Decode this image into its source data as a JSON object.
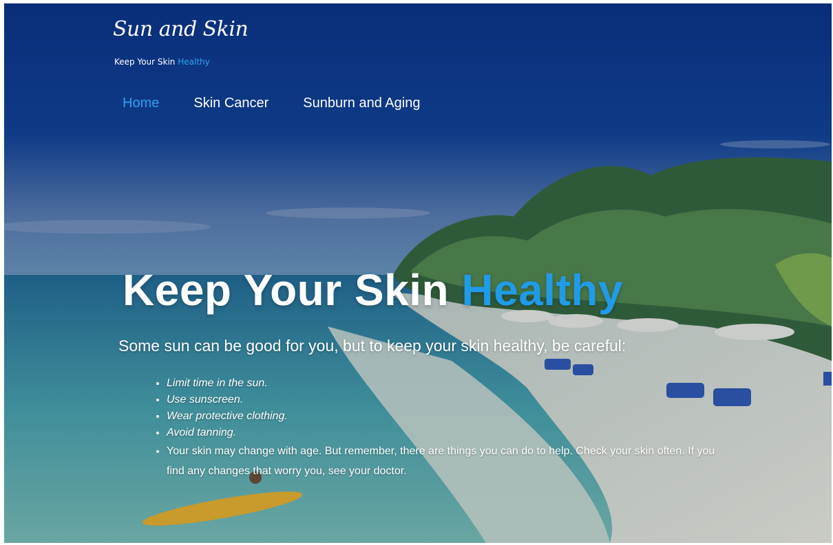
{
  "site": {
    "logo": "Sun and Skin",
    "tagline": {
      "main": "Keep Your Skin ",
      "accent": "Healthy"
    }
  },
  "nav": {
    "items": [
      {
        "label": "Home",
        "active": true
      },
      {
        "label": "Skin Cancer",
        "active": false
      },
      {
        "label": "Sunburn and Aging",
        "active": false
      }
    ]
  },
  "hero": {
    "title": {
      "main": "Keep Your Skin ",
      "accent": "Healthy"
    },
    "subtitle": "Some sun can be good for you, but to keep your skin healthy, be careful:",
    "tips": [
      "Limit time in the sun.",
      "Use sunscreen.",
      "Wear protective clothing.",
      "Avoid tanning.",
      "Your skin may change with age. But remember, there are things you can do to help. Check your skin often. If you find any changes that worry you, see your doctor."
    ]
  },
  "theme": {
    "accent": "#1f9be8",
    "nav_active": "#29a2ee",
    "sky_top": "#0a2e7a",
    "text": "#ffffff"
  },
  "background": {
    "description_icon": "beach-background-photo"
  }
}
